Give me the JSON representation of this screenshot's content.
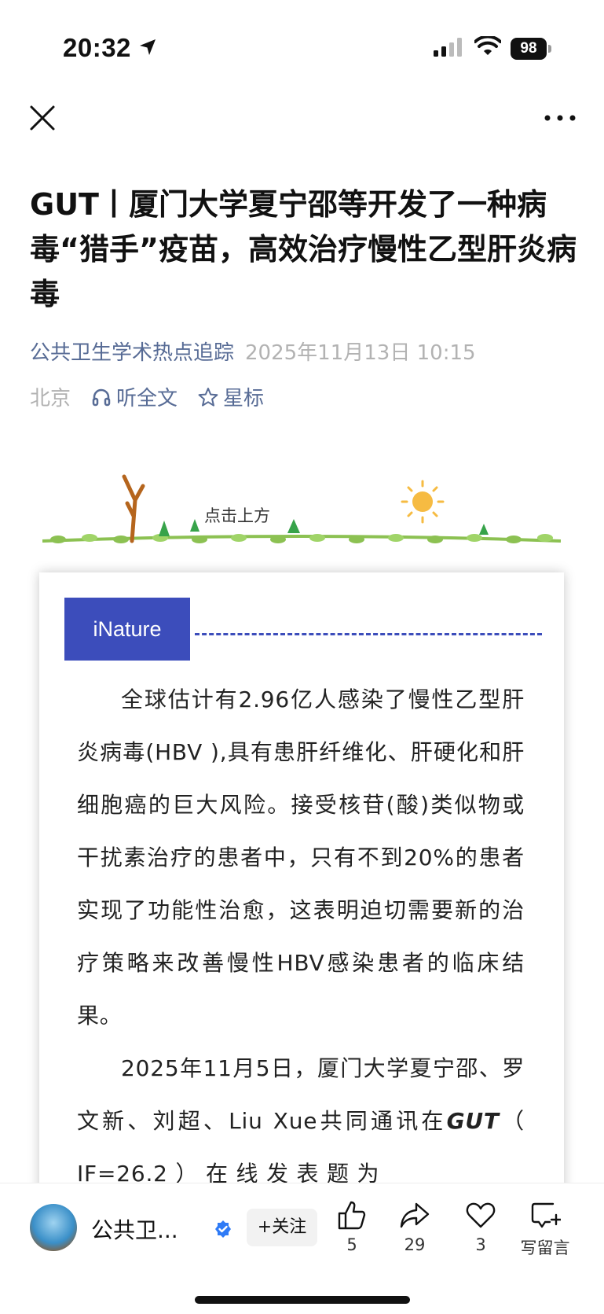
{
  "status_bar": {
    "time": "20:32",
    "battery": "98",
    "icons": [
      "location-arrow-icon",
      "signal-icon",
      "wifi-icon",
      "battery-icon"
    ]
  },
  "nav": {
    "close_icon": "close-icon",
    "more_icon": "more-icon"
  },
  "article": {
    "title": "GUT丨厦门大学夏宁邵等开发了一种病毒“猎手”疫苗，高效治疗慢性乙型肝炎病毒",
    "account": "公共卫生学术热点追踪",
    "date": "2025年11月13日 10:15",
    "location": "北京",
    "listen_label": "听全文",
    "star_label": "星标",
    "banner_text": "点击上方",
    "tag_label": "iNature",
    "para1": "全球估计有2.96亿人感染了慢性乙型肝炎病毒(HBV ),具有患肝纤维化、肝硬化和肝细胞癌的巨大风险。接受核苷(酸)类似物或干扰素治疗的患者中，只有不到20%的患者实现了功能性治愈，这表明迫切需要新的治疗策略来改善慢性HBV感染患者的临床结果。",
    "para2_part1": "2025年11月5日，厦门大学夏宁邵、罗文新、刘超、Liu Xue共同通讯在",
    "para2_journal": "GUT",
    "para2_part2": "（ IF=26.2 ） 在 线 发 表 题 为"
  },
  "bottom_bar": {
    "account_short": "公共卫...",
    "follow_label": "+关注",
    "like_count": "5",
    "share_count": "29",
    "favorite_count": "3",
    "comment_label": "写留言"
  },
  "colors": {
    "link_blue": "#576b95",
    "tag_blue": "#3c4dbb",
    "meta_gray": "#b2b2b2",
    "verified_blue": "#2f7bf6"
  }
}
